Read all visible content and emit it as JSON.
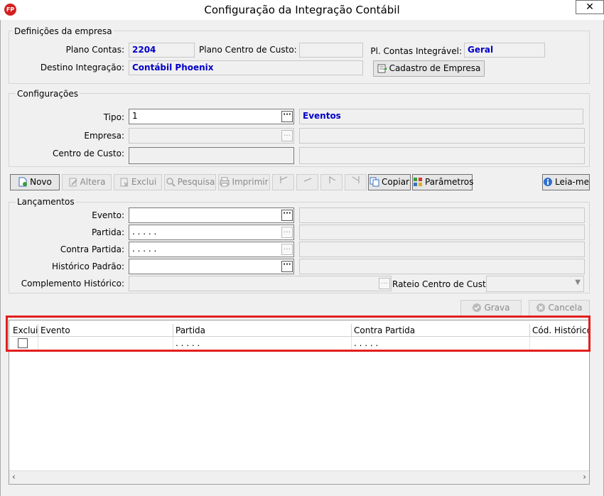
{
  "window": {
    "title": "Configuração da Integração Contábil",
    "app_icon_text": "FP",
    "close_glyph": "✕"
  },
  "empresa": {
    "group_title": "Definições da empresa",
    "plano_contas_label": "Plano Contas:",
    "plano_contas_value": "2204",
    "plano_centro_label": "Plano Centro de Custo:",
    "plano_centro_value": "",
    "pl_contas_label": "Pl. Contas Integrável:",
    "pl_contas_value": "Geral",
    "destino_label": "Destino Integração:",
    "destino_value": "Contábil Phoenix",
    "cadastro_button": "Cadastro de Empresa"
  },
  "config": {
    "group_title": "Configurações",
    "tipo_label": "Tipo:",
    "tipo_value": "1",
    "tipo_desc": "Eventos",
    "empresa_label": "Empresa:",
    "centro_label": "Centro de Custo:"
  },
  "toolbar": {
    "novo": "Novo",
    "altera": "Altera",
    "exclui": "Exclui",
    "pesquisa": "Pesquisa",
    "imprimir": "Imprimir",
    "copiar": "Copiar",
    "parametros": "Parâmetros",
    "leiame": "Leia-me"
  },
  "lancamentos": {
    "group_title": "Lançamentos",
    "evento_label": "Evento:",
    "partida_label": "Partida:",
    "partida_mask": ". . . . .",
    "contra_label": "Contra Partida:",
    "contra_mask": ". . . . .",
    "historico_label": "Histórico Padrão:",
    "complemento_label": "Complemento Histórico:",
    "rateio_label": "Rateio Centro de Custo:"
  },
  "actions": {
    "grava": "Grava",
    "cancela": "Cancela"
  },
  "grid": {
    "columns": [
      "Excluir",
      "Evento",
      "Partida",
      "Contra Partida",
      "Cód. Histórico"
    ],
    "row": {
      "partida": ". . . . .",
      "contra": ". . . . ."
    }
  },
  "colors": {
    "highlight": "#e31e1e",
    "value_text": "#0000c8"
  }
}
